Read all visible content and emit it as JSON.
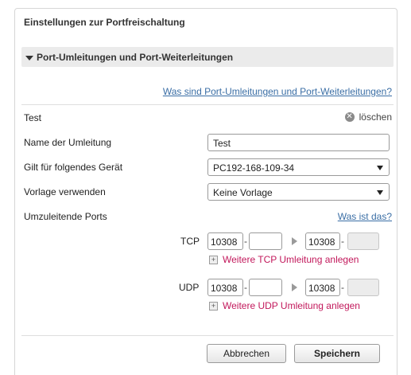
{
  "panel": {
    "title": "Einstellungen zur Portfreischaltung",
    "section_title": "Port-Umleitungen und Port-Weiterleitungen",
    "help_link": "Was sind Port-Umleitungen und Port-Weiterleitungen?"
  },
  "entry": {
    "name": "Test",
    "delete_label": "löschen"
  },
  "form": {
    "name_label": "Name der Umleitung",
    "name_value": "Test",
    "device_label": "Gilt für folgendes Gerät",
    "device_value": "PC192-168-109-34",
    "template_label": "Vorlage verwenden",
    "template_value": "Keine Vorlage",
    "ports_label": "Umzuleitende Ports",
    "ports_help_link": "Was ist das?"
  },
  "tcp": {
    "label": "TCP",
    "from_start": "10308",
    "from_end": "",
    "to_start": "10308",
    "to_end": "",
    "add_more": "Weitere TCP Umleitung anlegen"
  },
  "udp": {
    "label": "UDP",
    "from_start": "10308",
    "from_end": "",
    "to_start": "10308",
    "to_end": "",
    "add_more": "Weitere UDP Umleitung anlegen"
  },
  "buttons": {
    "cancel": "Abbrechen",
    "save": "Speichern"
  },
  "symbols": {
    "delete": "✕",
    "plus": "+",
    "dash": "-"
  },
  "colors": {
    "link": "#3a6ea5",
    "add_link": "#c2185b",
    "section_bg": "#ebebeb"
  }
}
